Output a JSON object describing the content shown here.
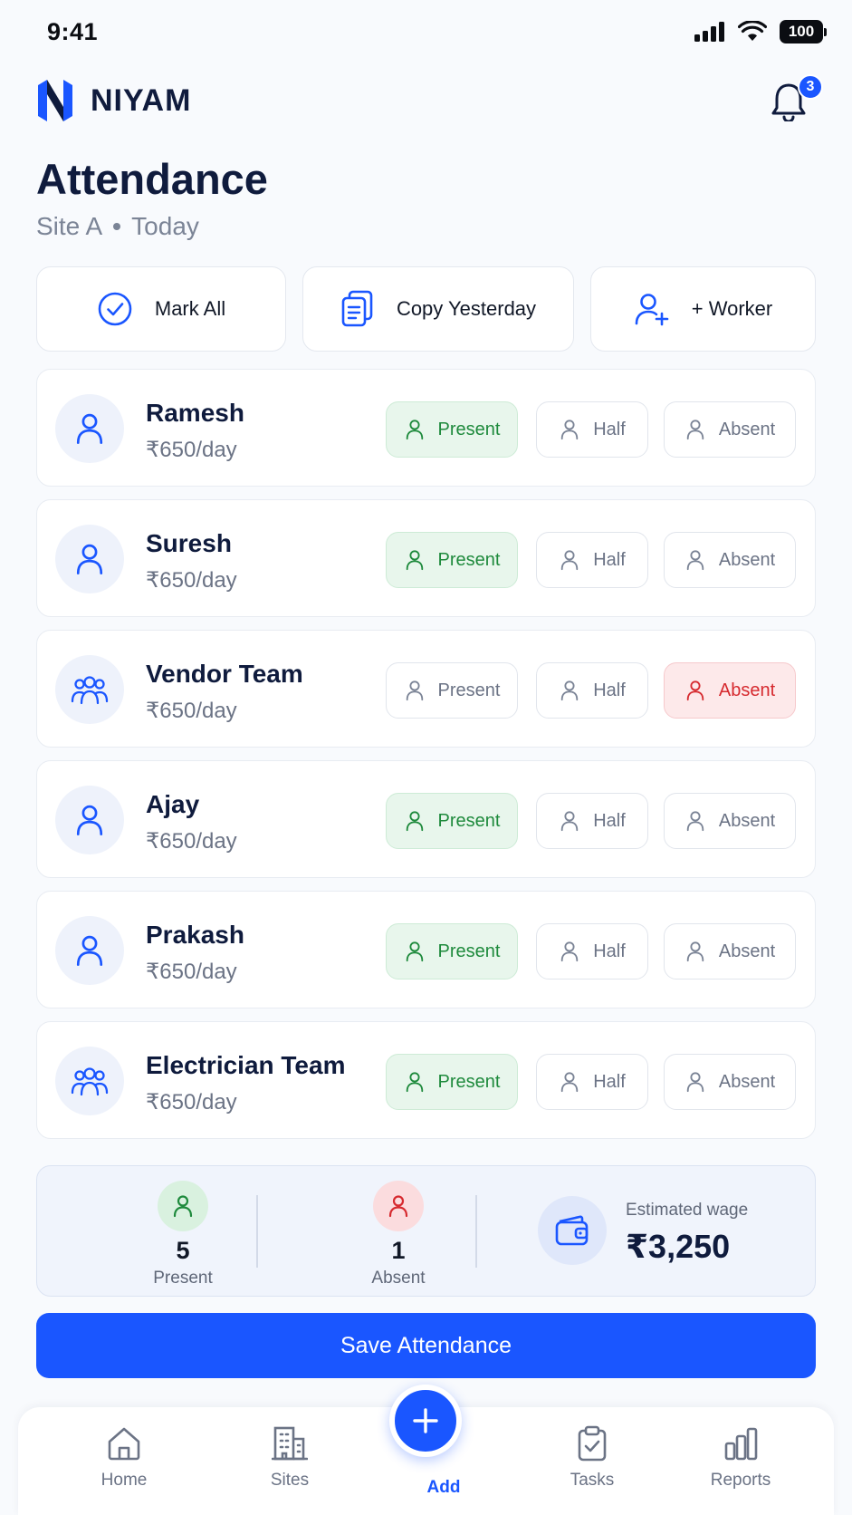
{
  "status": {
    "time": "9:41",
    "battery": "100"
  },
  "brand": {
    "name": "NIYAM"
  },
  "notifications": {
    "count": "3"
  },
  "page": {
    "title": "Attendance",
    "site": "Site A",
    "period": "Today"
  },
  "actions": [
    {
      "label": "Mark All",
      "icon": "check-circle-icon"
    },
    {
      "label": "Copy Yesterday",
      "icon": "copy-icon"
    },
    {
      "label": "+ Worker",
      "icon": "user-plus-icon"
    }
  ],
  "status_labels": {
    "present": "Present",
    "half": "Half",
    "absent": "Absent"
  },
  "workers": [
    {
      "name": "Ramesh",
      "rate": "₹650/day",
      "type": "person",
      "status": "present"
    },
    {
      "name": "Suresh",
      "rate": "₹650/day",
      "type": "person",
      "status": "present"
    },
    {
      "name": "Vendor Team",
      "rate": "₹650/day",
      "type": "team",
      "status": "absent"
    },
    {
      "name": "Ajay",
      "rate": "₹650/day",
      "type": "person",
      "status": "present"
    },
    {
      "name": "Prakash",
      "rate": "₹650/day",
      "type": "person",
      "status": "present"
    },
    {
      "name": "Electrician Team",
      "rate": "₹650/day",
      "type": "team",
      "status": "present"
    }
  ],
  "summary": {
    "present_count": "5",
    "present_label": "Present",
    "absent_count": "1",
    "absent_label": "Absent",
    "wage_label": "Estimated wage",
    "wage_value": "₹3,250"
  },
  "save_label": "Save Attendance",
  "nav": [
    {
      "label": "Home",
      "icon": "home-icon"
    },
    {
      "label": "Sites",
      "icon": "building-icon"
    },
    {
      "label": "Add",
      "icon": "plus-icon",
      "active": true
    },
    {
      "label": "Tasks",
      "icon": "clipboard-check-icon"
    },
    {
      "label": "Reports",
      "icon": "bar-chart-icon"
    }
  ],
  "colors": {
    "accent": "#1a56ff",
    "present_bg": "#e8f6ec",
    "present_text": "#1e8a3c",
    "absent_bg": "#fde9ea",
    "absent_text": "#d62a2f"
  }
}
